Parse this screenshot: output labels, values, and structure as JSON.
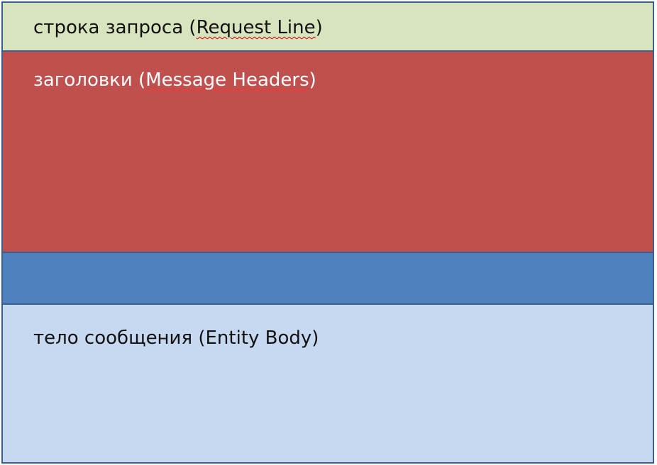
{
  "blocks": {
    "request_line": {
      "prefix": "строка запроса (",
      "term": "Request Line",
      "suffix": ")"
    },
    "headers": {
      "prefix": "заголовки (",
      "term": "Message Headers",
      "suffix": ")"
    },
    "separator": {},
    "body": {
      "text": "тело сообщения (Entity Body)"
    }
  },
  "colors": {
    "request_line": "#d7e4bd",
    "headers": "#c0504d",
    "separator": "#4f81bd",
    "body": "#c6d9f1",
    "border": "#3b5f8d",
    "spellcheck_underline": "#d00000"
  }
}
